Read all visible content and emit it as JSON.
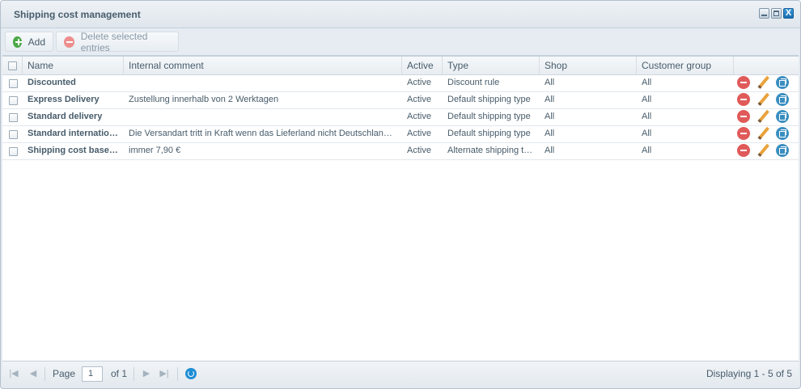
{
  "window": {
    "title": "Shipping cost management",
    "close_glyph": "X"
  },
  "toolbar": {
    "add_label": "Add",
    "delete_label": "Delete selected entries"
  },
  "grid": {
    "columns": [
      "Name",
      "Internal comment",
      "Active",
      "Type",
      "Shop",
      "Customer group"
    ],
    "rows": [
      {
        "name": "Discounted",
        "comment": "",
        "active": "Active",
        "type": "Discount rule",
        "shop": "All",
        "group": "All"
      },
      {
        "name": "Express Delivery",
        "comment": "Zustellung innerhalb von 2 Werktagen",
        "active": "Active",
        "type": "Default shipping type",
        "shop": "All",
        "group": "All"
      },
      {
        "name": "Standard delivery",
        "comment": "",
        "active": "Active",
        "type": "Default shipping type",
        "shop": "All",
        "group": "All"
      },
      {
        "name": "Standard internatio…",
        "comment": "Die Versandart tritt in Kraft wenn das Lieferland nicht Deutschlan…",
        "active": "Active",
        "type": "Default shipping type",
        "shop": "All",
        "group": "All"
      },
      {
        "name": "Shipping cost base…",
        "comment": "immer 7,90 €",
        "active": "Active",
        "type": "Alternate shipping t…",
        "shop": "All",
        "group": "All"
      }
    ]
  },
  "pager": {
    "page_label": "Page",
    "page_value": "1",
    "of_label": "of 1",
    "display_text": "Displaying 1 - 5 of 5"
  },
  "colors": {
    "accent": "#1f8ed4",
    "add_green": "#4aa845",
    "delete_red": "#e05a5a",
    "edit_orange": "#e9a23b"
  }
}
